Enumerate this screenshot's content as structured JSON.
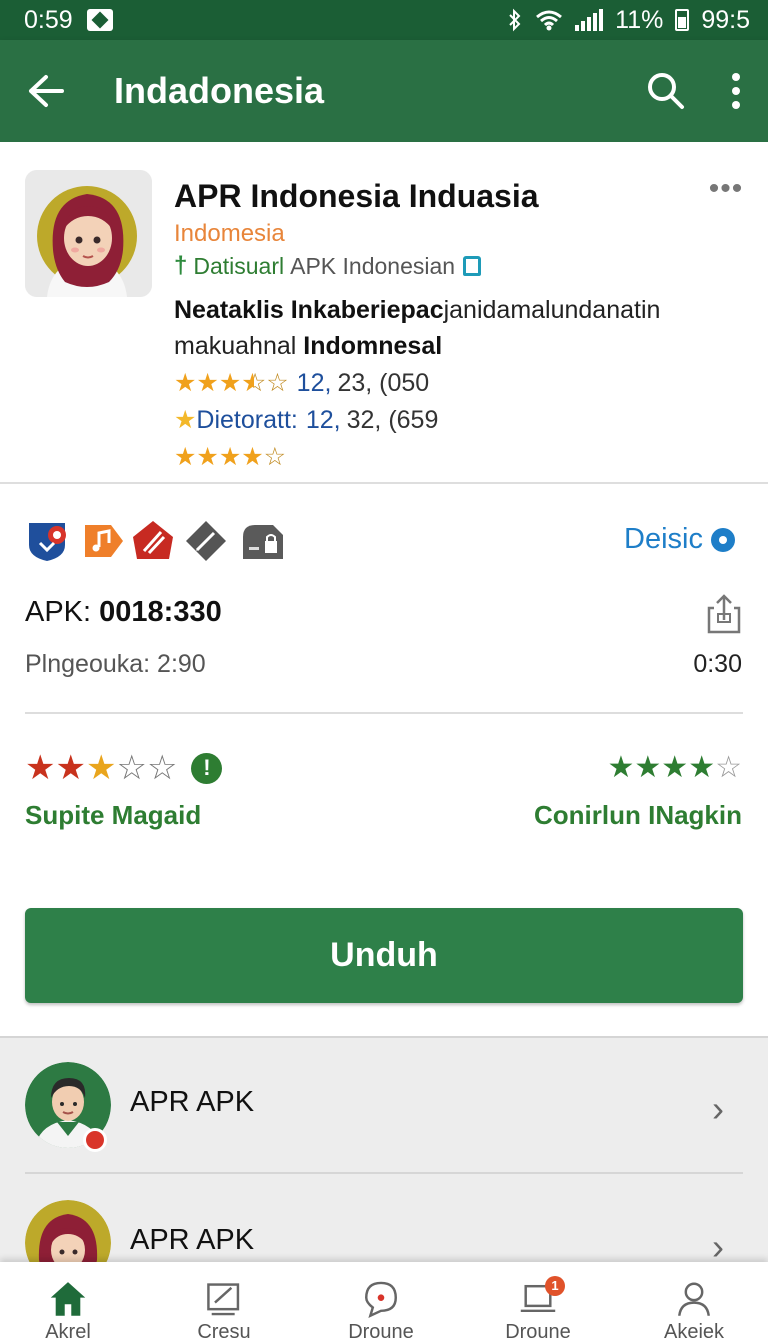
{
  "status_bar": {
    "time": "0:59",
    "battery": "11%",
    "clock_right": "99:5",
    "icons": [
      "notification-icon",
      "bluetooth-icon",
      "wifi-icon",
      "signal-icon",
      "battery-icon"
    ]
  },
  "app_bar": {
    "title": "Indadonesia",
    "icons": [
      "back-arrow-icon",
      "search-icon",
      "more-vert-icon"
    ]
  },
  "app_header": {
    "name": "APR Indonesia Induasia",
    "country": "Indomesia",
    "developer": "Datisuarl",
    "developer_suffix": "APK Indonesian",
    "desc_line1_bold": "Neataklis Inkaberiepac",
    "desc_line1_rest": "janidamalundanatin",
    "desc_line2_rest": "makuahnal",
    "desc_line2_bold": "Indomnesal",
    "rating1_count": "12,",
    "rating1_rest": "23, (050",
    "rating2_label": "Dietoratt:",
    "rating2_count": "12,",
    "rating2_rest": "32, (659",
    "more_glyph": "•••",
    "star_rating_1": 3.5,
    "star_rating_3": 3.5
  },
  "info": {
    "badges": [
      "shield-badge-icon",
      "music-badge-icon",
      "tool-badge-icon",
      "pen-badge-icon",
      "lock-badge-icon"
    ],
    "devices_label": "Deisic",
    "apk_label": "APK:",
    "apk_value": "0018:330",
    "upload_label": "Plngeouka: 2:90",
    "upload_time": "0:30"
  },
  "ratings": {
    "left_label": "Supite Magaid",
    "right_label": "Conirlun INagkin",
    "left_stars": 3.5,
    "right_stars": 4
  },
  "download": {
    "label": "Unduh"
  },
  "related": [
    {
      "title": "APR APK"
    },
    {
      "title": "APR APK"
    }
  ],
  "bottom_nav": [
    {
      "label": "Akrel",
      "icon": "home-icon",
      "active": true
    },
    {
      "label": "Cresu",
      "icon": "edit-icon"
    },
    {
      "label": "Droune",
      "icon": "chat-icon"
    },
    {
      "label": "Droune",
      "icon": "laptop-icon",
      "badge": "1"
    },
    {
      "label": "Akeiek",
      "icon": "profile-icon"
    }
  ],
  "colors": {
    "app_bar": "#2a7044",
    "status_bar": "#1b5e35",
    "primary_green": "#2e8049",
    "link_blue": "#1e7ec8",
    "star_gold": "#f0a11c",
    "country_orange": "#e8853a"
  }
}
